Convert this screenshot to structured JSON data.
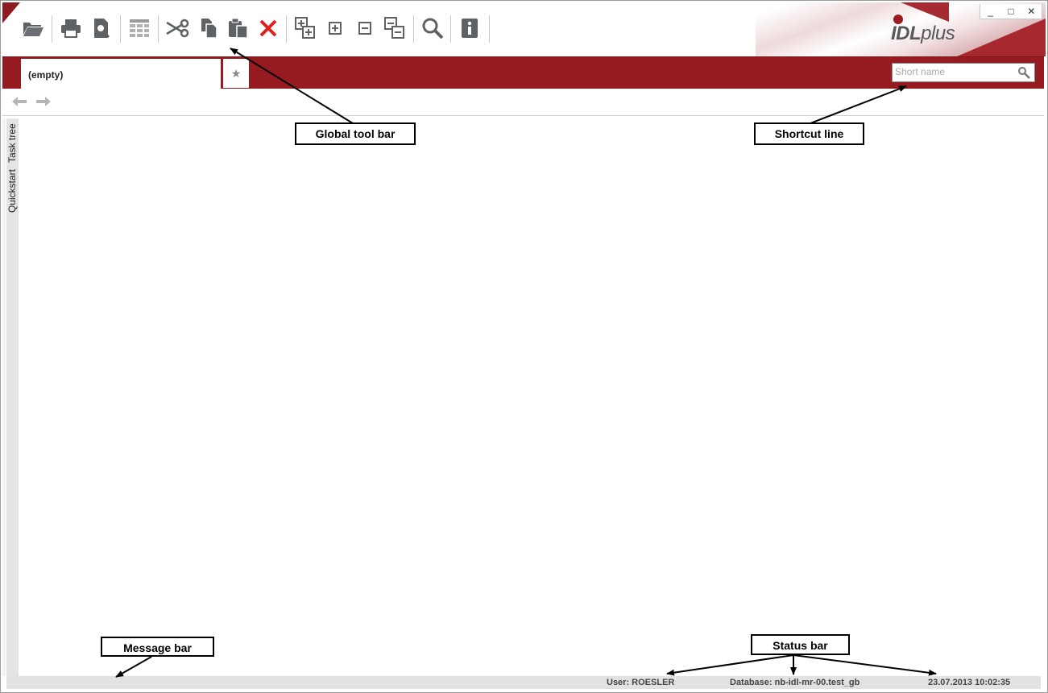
{
  "window": {
    "controls": {
      "minimize": "_",
      "maximize": "□",
      "close": "✕"
    }
  },
  "logo": {
    "prefix": "IDL",
    "suffix": "plus",
    "brand_color": "#961b21"
  },
  "toolbar": {
    "icons": [
      "folder-open-icon",
      "print-icon",
      "print-preview-icon",
      "table-icon",
      "cut-icon",
      "copy-icon",
      "paste-icon",
      "delete-icon",
      "expand-all-icon",
      "expand-icon",
      "collapse-icon",
      "collapse-all-icon",
      "search-icon",
      "info-icon"
    ]
  },
  "tabs": [
    {
      "label": "(empty)"
    }
  ],
  "shortcut": {
    "placeholder": "Short name"
  },
  "side_tabs": [
    {
      "label": "Quickstart"
    },
    {
      "label": "Task tree"
    }
  ],
  "status": {
    "user": "User: ROESLER",
    "database": "Database: nb-idl-mr-00.test_gb",
    "datetime": "23.07.2013 10:02:35"
  },
  "annotations": {
    "global_toolbar": "Global tool bar",
    "shortcut_line": "Shortcut line",
    "message_bar": "Message bar",
    "status_bar": "Status bar"
  },
  "colors": {
    "accent": "#961b21",
    "icon_gray": "#666666",
    "delete_red": "#e02020"
  }
}
